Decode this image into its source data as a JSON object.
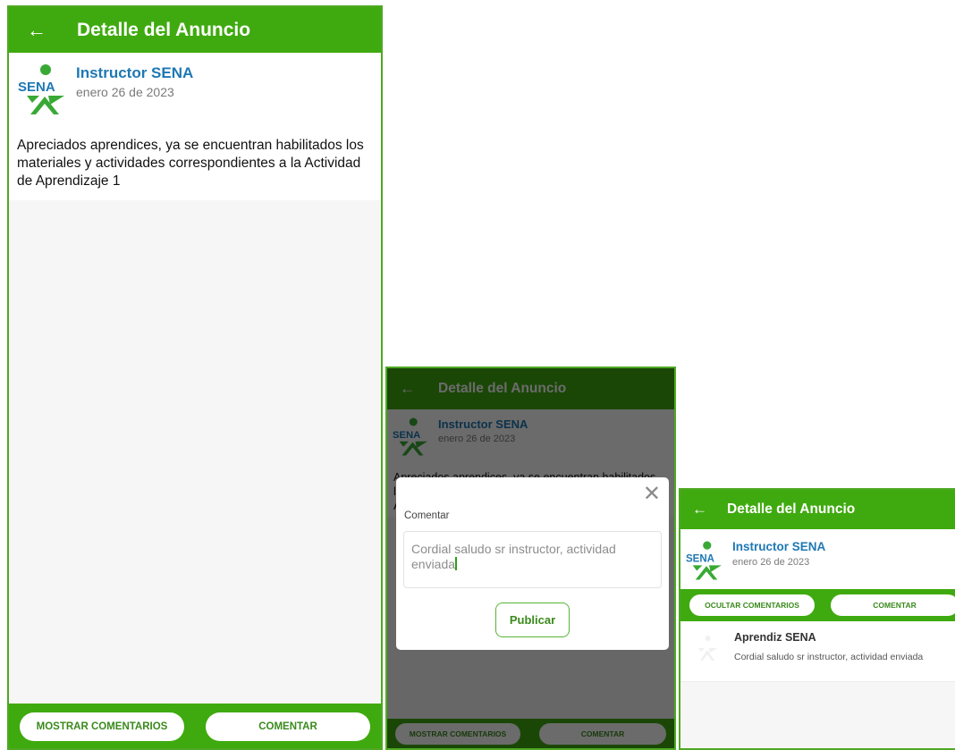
{
  "header": {
    "title": "Detalle del Anuncio",
    "back_icon": "←"
  },
  "post": {
    "author": "Instructor SENA",
    "date": "enero 26 de 2023",
    "body": "Apreciados aprendices, ya se encuentran habilitados los materiales y actividades correspondientes a la Actividad de Aprendizaje 1",
    "logo_text": "SENA"
  },
  "actions": {
    "show_comments": "MOSTRAR COMENTARIOS",
    "hide_comments": "OCULTAR COMENTARIOS",
    "comment": "COMENTAR"
  },
  "dialog": {
    "label": "Comentar",
    "close_icon": "✕",
    "input_value": "Cordial saludo sr instructor, actividad enviada",
    "publish": "Publicar"
  },
  "comment": {
    "author": "Aprendiz SENA",
    "text": "Cordial saludo sr instructor, actividad enviada"
  },
  "colors": {
    "brand_green": "#3faa0f",
    "author_blue": "#1e78b4",
    "logo_green": "#39a935",
    "logo_blue": "#1e78b4"
  }
}
